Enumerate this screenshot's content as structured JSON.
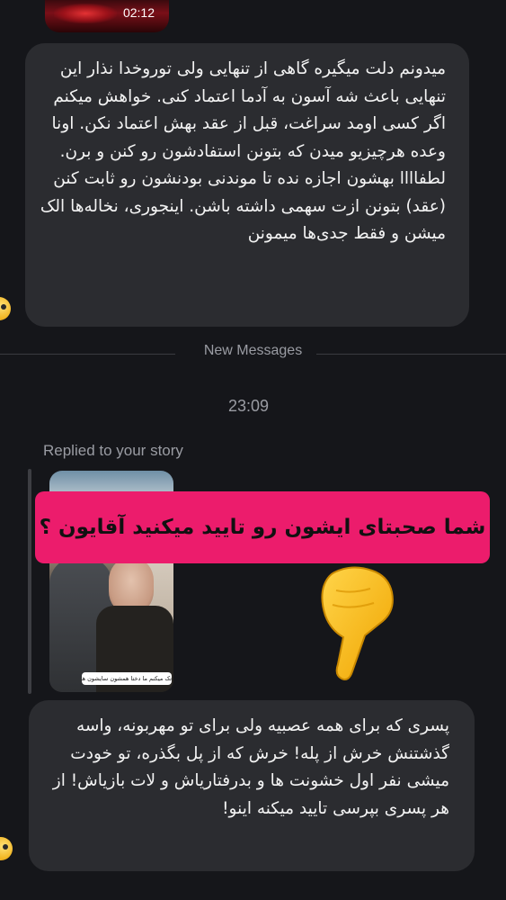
{
  "top_thumbnail": {
    "duration": "02:12"
  },
  "message_1": {
    "text": "میدونم دلت میگیره گاهی از تنهایی ولی تورو‌خدا نذار این تنهایی باعث شه آسون به آدما اعتماد کنی. خواهش میکنم اگر کسی اومد سراغت، قبل از عقد بهش اعتماد نکن. اونا وعده هرچیزیو میدن که بتونن استفادشون رو کنن و برن. لطفاااا بهشون اجازه نده تا موندنی بودنشون رو ثابت کنن (عقد) بتونن ازت سهمی داشته باشن. اینجوری، نخاله‌ها الک میشن و فقط جدی‌ها میمونن"
  },
  "divider": {
    "label": "New Messages"
  },
  "timestamp": "23:09",
  "reply": {
    "label": "Replied to your story",
    "story_banner": "شما صحبتای ایشون رو تایید میکنید آقایون ؟",
    "story_caption": "تک میکنم ما دختا همشون سایشون هستن"
  },
  "message_2": {
    "text": "پسری که برای همه عصبیه ولی برای تو مهربونه، واسه گذشتنش خرش از پله! خرش که از پل بگذره، تو خودت میشی نفر اول خشونت ها و بدرفتاریاش و لات بازیاش! از هر پسری بپرسی تایید میکنه اینو!"
  },
  "icons": {
    "avatar": "avatar-icon",
    "pointing_hand": "pointing-down-hand-emoji"
  }
}
